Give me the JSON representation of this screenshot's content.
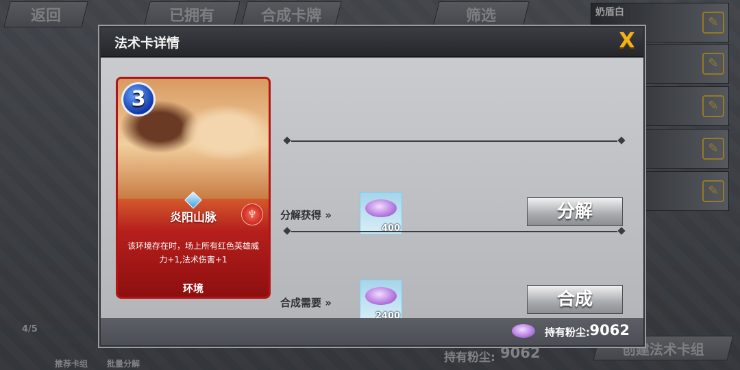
{
  "background": {
    "back_button": "返回",
    "tabs": [
      "已拥有",
      "合成卡牌",
      "筛选"
    ],
    "side_card_name": "奶盾白",
    "page_indicator": "4/5",
    "bottom_labels": [
      "推荐卡组",
      "批量分解"
    ],
    "dust_label": "持有粉尘:",
    "dust_value": "9062",
    "create_deck_button": "创建法术卡组"
  },
  "modal": {
    "title": "法术卡详情",
    "close_label": "X",
    "card": {
      "cost": "3",
      "name": "炎阳山脉",
      "description": "该环境存在时，场上所有红色英雄威力+1,法术伤害+1",
      "type": "环境"
    },
    "disenchant": {
      "label": "分解获得",
      "dust_amount": "400",
      "button": "分解"
    },
    "craft": {
      "label": "合成需要",
      "dust_amount": "2400",
      "button": "合成"
    },
    "footer": {
      "dust_label": "持有粉尘:",
      "dust_value": "9062"
    }
  },
  "colors": {
    "accent_close": "#f3b21c",
    "card_frame": "#b41414",
    "dust_purple": "#b47ae0"
  }
}
